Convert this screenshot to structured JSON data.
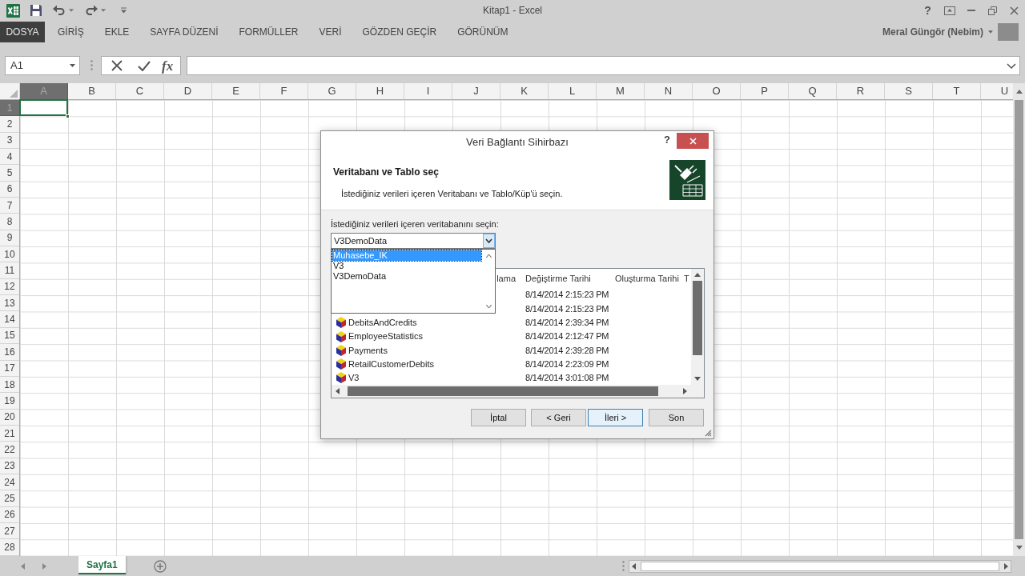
{
  "title_bar": {
    "title": "Kitap1 - Excel",
    "help": "?"
  },
  "ribbon": {
    "tabs": [
      {
        "label": "DOSYA",
        "kind": "file"
      },
      {
        "label": "GİRİŞ",
        "kind": "tab"
      },
      {
        "label": "EKLE",
        "kind": "tab"
      },
      {
        "label": "SAYFA DÜZENİ",
        "kind": "tab"
      },
      {
        "label": "FORMÜLLER",
        "kind": "tab"
      },
      {
        "label": "VERİ",
        "kind": "tab"
      },
      {
        "label": "GÖZDEN GEÇİR",
        "kind": "tab"
      },
      {
        "label": "GÖRÜNÜM",
        "kind": "tab"
      }
    ],
    "user": "Meral Güngör (Nebim)"
  },
  "formula_bar": {
    "name_box": "A1",
    "function_label": "fx"
  },
  "sheet": {
    "columns": [
      {
        "label": "A",
        "selected": true
      },
      {
        "label": "B",
        "selected": false
      },
      {
        "label": "C",
        "selected": false
      },
      {
        "label": "D",
        "selected": false
      },
      {
        "label": "E",
        "selected": false
      },
      {
        "label": "F",
        "selected": false
      },
      {
        "label": "G",
        "selected": false
      },
      {
        "label": "H",
        "selected": false
      },
      {
        "label": "I",
        "selected": false
      },
      {
        "label": "J",
        "selected": false
      },
      {
        "label": "K",
        "selected": false
      },
      {
        "label": "L",
        "selected": false
      },
      {
        "label": "M",
        "selected": false
      },
      {
        "label": "N",
        "selected": false
      },
      {
        "label": "O",
        "selected": false
      },
      {
        "label": "P",
        "selected": false
      },
      {
        "label": "Q",
        "selected": false
      },
      {
        "label": "R",
        "selected": false
      },
      {
        "label": "S",
        "selected": false
      },
      {
        "label": "T",
        "selected": false
      },
      {
        "label": "U",
        "selected": false
      }
    ],
    "rows": [
      {
        "label": "1",
        "selected": true
      },
      {
        "label": "2",
        "selected": false
      },
      {
        "label": "3",
        "selected": false
      },
      {
        "label": "4",
        "selected": false
      },
      {
        "label": "5",
        "selected": false
      },
      {
        "label": "6",
        "selected": false
      },
      {
        "label": "7",
        "selected": false
      },
      {
        "label": "8",
        "selected": false
      },
      {
        "label": "9",
        "selected": false
      },
      {
        "label": "10",
        "selected": false
      },
      {
        "label": "11",
        "selected": false
      },
      {
        "label": "12",
        "selected": false
      },
      {
        "label": "13",
        "selected": false
      },
      {
        "label": "14",
        "selected": false
      },
      {
        "label": "15",
        "selected": false
      },
      {
        "label": "16",
        "selected": false
      },
      {
        "label": "17",
        "selected": false
      },
      {
        "label": "18",
        "selected": false
      },
      {
        "label": "19",
        "selected": false
      },
      {
        "label": "20",
        "selected": false
      },
      {
        "label": "21",
        "selected": false
      },
      {
        "label": "22",
        "selected": false
      },
      {
        "label": "23",
        "selected": false
      },
      {
        "label": "24",
        "selected": false
      },
      {
        "label": "25",
        "selected": false
      },
      {
        "label": "26",
        "selected": false
      },
      {
        "label": "27",
        "selected": false
      },
      {
        "label": "28",
        "selected": false
      }
    ]
  },
  "sheet_tabs": [
    {
      "label": "Sayfa1",
      "selected": true
    }
  ],
  "dialog": {
    "title": "Veri Bağlantı Sihirbazı",
    "help": "?",
    "heading": "Veritabanı ve Tablo seç",
    "subheading": "İstediğiniz verileri içeren Veritabanı ve Tablo/Küp'ü seçin.",
    "database_label": "İstediğiniz verileri içeren veritabanını seçin:",
    "database_value": "V3DemoData",
    "database_options": [
      {
        "label": "Muhasebe_IK",
        "selected": true
      },
      {
        "label": "V3",
        "selected": false
      },
      {
        "label": "V3DemoData",
        "selected": false
      }
    ],
    "table_list": {
      "columns": [
        "lama",
        "Değiştirme Tarihi",
        "Oluşturma Tarihi",
        "T"
      ],
      "rows": [
        {
          "modified": "8/14/2014 2:15:23 PM"
        },
        {
          "modified": "8/14/2014 2:15:23 PM"
        },
        {
          "name": "DebitsAndCredits",
          "modified": "8/14/2014 2:39:34 PM"
        },
        {
          "name": "EmployeeStatistics",
          "modified": "8/14/2014 2:12:47 PM"
        },
        {
          "name": "Payments",
          "modified": "8/14/2014 2:39:28 PM"
        },
        {
          "name": "RetailCustomerDebits",
          "modified": "8/14/2014 2:23:09 PM"
        },
        {
          "name": "V3",
          "modified": "8/14/2014 3:01:08 PM"
        }
      ]
    },
    "buttons": [
      {
        "label": "İptal",
        "focused": false
      },
      {
        "label": "< Geri",
        "focused": false
      },
      {
        "label": "İleri >",
        "focused": true
      },
      {
        "label": "Son",
        "focused": false
      }
    ]
  }
}
